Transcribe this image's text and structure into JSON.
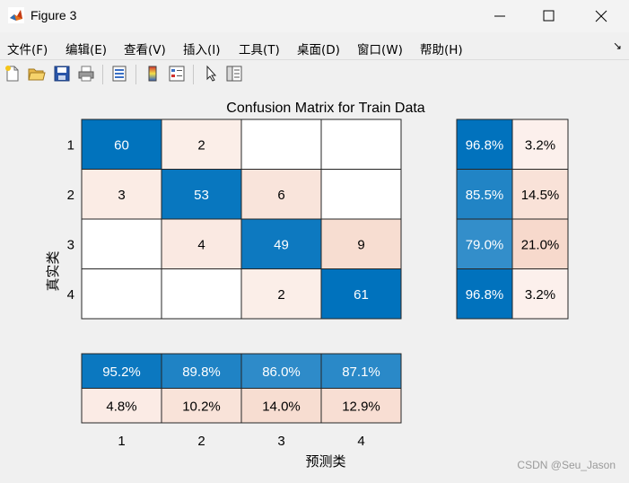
{
  "window": {
    "title": "Figure 3"
  },
  "menu": {
    "items": [
      "文件(F)",
      "编辑(E)",
      "查看(V)",
      "插入(I)",
      "工具(T)",
      "桌面(D)",
      "窗口(W)",
      "帮助(H)"
    ]
  },
  "toolbar": {
    "icons": [
      "new-file-icon",
      "open-folder-icon",
      "save-icon",
      "print-icon",
      "print-preview-icon",
      "colorbar-icon",
      "legend-icon",
      "pointer-icon",
      "property-inspector-icon"
    ]
  },
  "chart_data": {
    "type": "heatmap",
    "title": "Confusion Matrix for Train Data",
    "xlabel": "预测类",
    "ylabel": "真实类",
    "row_labels": [
      "1",
      "2",
      "3",
      "4"
    ],
    "col_labels": [
      "1",
      "2",
      "3",
      "4"
    ],
    "matrix": [
      [
        60,
        2,
        null,
        null
      ],
      [
        3,
        53,
        6,
        null
      ],
      [
        null,
        4,
        49,
        9
      ],
      [
        null,
        null,
        2,
        61
      ]
    ],
    "row_summary": [
      [
        "96.8%",
        "3.2%"
      ],
      [
        "85.5%",
        "14.5%"
      ],
      [
        "79.0%",
        "21.0%"
      ],
      [
        "96.8%",
        "3.2%"
      ]
    ],
    "column_summary": [
      [
        "95.2%",
        "89.8%",
        "86.0%",
        "87.1%"
      ],
      [
        "4.8%",
        "10.2%",
        "14.0%",
        "12.9%"
      ]
    ],
    "colors": {
      "correct": "#0072bd",
      "incorrect": "#d95319"
    }
  },
  "watermark": "CSDN @Seu_Jason"
}
